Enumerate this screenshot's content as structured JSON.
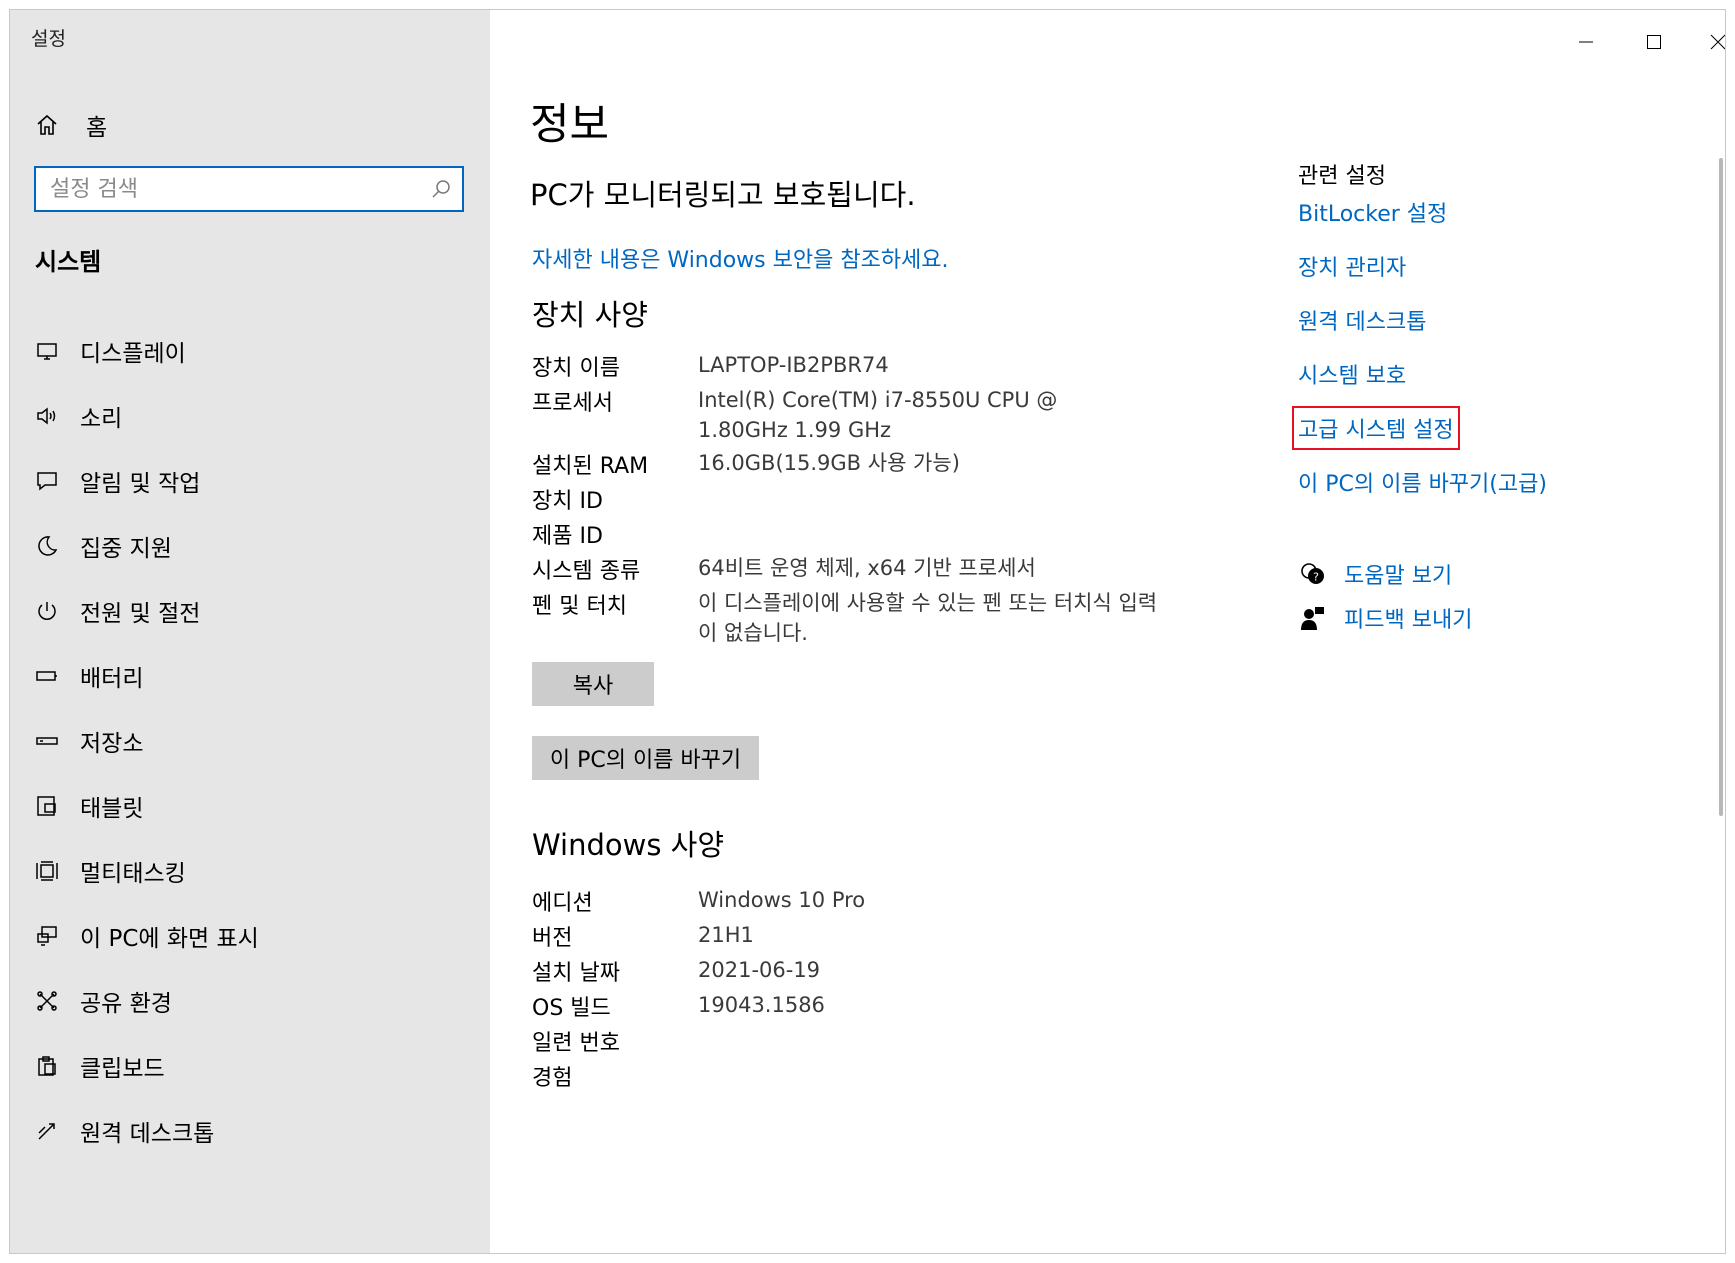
{
  "window": {
    "title": "설정"
  },
  "sidebar": {
    "home_label": "홈",
    "search_placeholder": "설정 검색",
    "section_title": "시스템",
    "items": [
      {
        "label": "디스플레이",
        "icon": "monitor-icon"
      },
      {
        "label": "소리",
        "icon": "speaker-icon"
      },
      {
        "label": "알림 및 작업",
        "icon": "notification-icon"
      },
      {
        "label": "집중 지원",
        "icon": "moon-icon"
      },
      {
        "label": "전원 및 절전",
        "icon": "power-icon"
      },
      {
        "label": "배터리",
        "icon": "battery-icon"
      },
      {
        "label": "저장소",
        "icon": "storage-icon"
      },
      {
        "label": "태블릿",
        "icon": "tablet-icon"
      },
      {
        "label": "멀티태스킹",
        "icon": "multitasking-icon"
      },
      {
        "label": "이 PC에 화면 표시",
        "icon": "project-icon"
      },
      {
        "label": "공유 환경",
        "icon": "shared-experiences-icon"
      },
      {
        "label": "클립보드",
        "icon": "clipboard-icon"
      },
      {
        "label": "원격 데스크톱",
        "icon": "remote-desktop-icon"
      }
    ]
  },
  "main": {
    "page_title": "정보",
    "security_status": "PC가 모니터링되고 보호됩니다.",
    "security_link": "자세한 내용은 Windows 보안을 참조하세요.",
    "device_specs": {
      "title": "장치 사양",
      "rows": [
        {
          "label": "장치 이름",
          "value": "LAPTOP-IB2PBR74"
        },
        {
          "label": "프로세서",
          "value": "Intel(R) Core(TM) i7-8550U CPU @ 1.80GHz 1.99 GHz"
        },
        {
          "label": "설치된 RAM",
          "value": "16.0GB(15.9GB 사용 가능)"
        },
        {
          "label": "장치 ID",
          "value": ""
        },
        {
          "label": "제품 ID",
          "value": ""
        },
        {
          "label": "시스템 종류",
          "value": "64비트 운영 체제, x64 기반 프로세서"
        },
        {
          "label": "펜 및 터치",
          "value": "이 디스플레이에 사용할 수 있는 펜 또는 터치식 입력이 없습니다."
        }
      ],
      "copy_button": "복사",
      "rename_button": "이 PC의 이름 바꾸기"
    },
    "windows_specs": {
      "title": "Windows 사양",
      "rows": [
        {
          "label": "에디션",
          "value": "Windows 10 Pro"
        },
        {
          "label": "버전",
          "value": "21H1"
        },
        {
          "label": "설치 날짜",
          "value": "2021-06-19"
        },
        {
          "label": "OS 빌드",
          "value": "19043.1586"
        },
        {
          "label": "일련 번호",
          "value": ""
        },
        {
          "label": "경험",
          "value": ""
        }
      ]
    }
  },
  "related": {
    "title": "관련 설정",
    "links": [
      {
        "label": "BitLocker 설정"
      },
      {
        "label": "장치 관리자"
      },
      {
        "label": "원격 데스크톱"
      },
      {
        "label": "시스템 보호"
      },
      {
        "label": "고급 시스템 설정",
        "highlighted": true
      },
      {
        "label": "이 PC의 이름 바꾸기(고급)"
      }
    ],
    "help_label": "도움말 보기",
    "feedback_label": "피드백 보내기"
  },
  "colors": {
    "accent": "#0067c0",
    "highlight": "#e81123",
    "sidebar_bg": "#e6e6e6",
    "button_bg": "#cccccc"
  }
}
